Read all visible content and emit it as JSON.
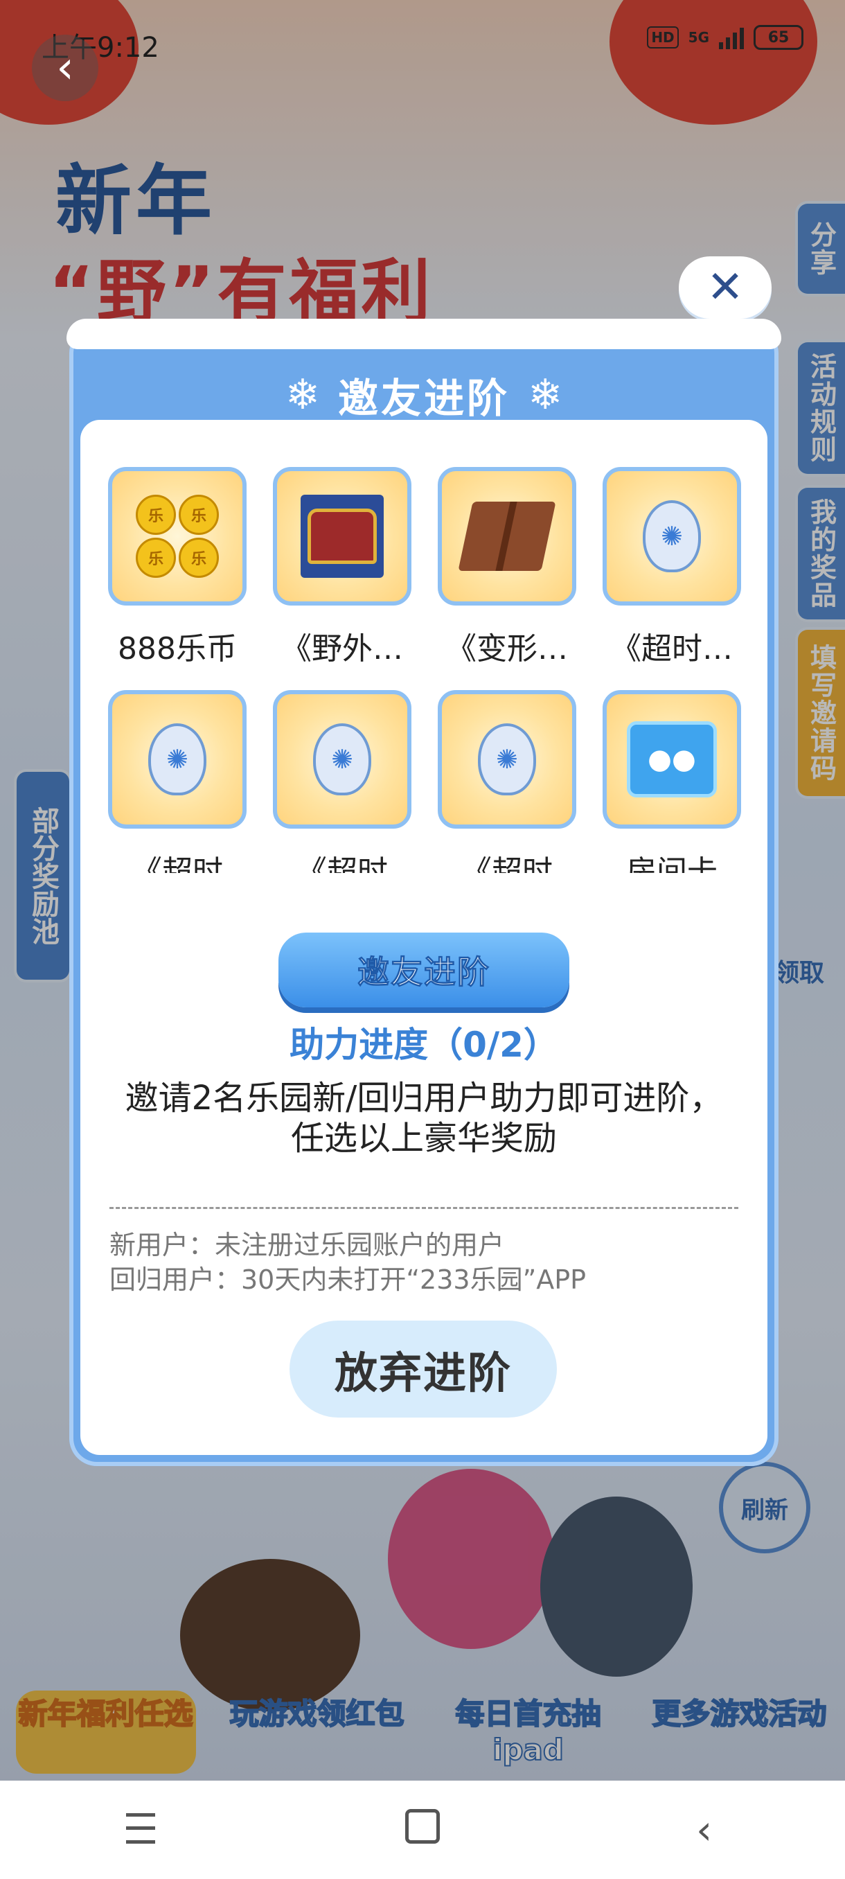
{
  "status_bar": {
    "time": "上午9:12",
    "network": "5G",
    "hd": "HD",
    "battery": "65"
  },
  "background": {
    "title_line1": "新年",
    "title_line2": "“野”有福利",
    "side_tabs": [
      "分享",
      "活动规则",
      "我的奖品",
      "填写邀请码"
    ],
    "left_tab": "部分奖励池",
    "peek_claim": "领取",
    "peek_refresh": "刷新",
    "bottom_nav": [
      "新年福利任选",
      "玩游戏领红包",
      "每日首充抽ipad",
      "更多游戏活动"
    ]
  },
  "modal": {
    "close_icon": "close-icon",
    "title": "邀友进阶",
    "rewards": [
      {
        "name": "888乐币",
        "icon": "coins-icon"
      },
      {
        "name": "《野外…",
        "icon": "treasure-chest-icon"
      },
      {
        "name": "《变形…",
        "icon": "gift-box-icon"
      },
      {
        "name": "《超时…",
        "icon": "egg-book-icon"
      },
      {
        "name": "《超时",
        "icon": "egg-gem-icon"
      },
      {
        "name": "《超时",
        "icon": "egg-crystal-icon"
      },
      {
        "name": "《超时",
        "icon": "egg-potion-icon"
      },
      {
        "name": "房间卡",
        "icon": "room-card-box-icon"
      }
    ],
    "primary_button": "邀友进阶",
    "progress": "助力进度（0/2）",
    "description_line1": "邀请2名乐园新/回归用户助力即可进阶，",
    "description_line2": "任选以上豪华奖励",
    "note_new_user": "新用户：未注册过乐园账户的用户",
    "note_return_user": "回归用户：30天内未打开“233乐园”APP",
    "giveup_button": "放弃进阶"
  },
  "colors": {
    "modal_frame": "#6da8ea",
    "progress_text": "#3a82d6",
    "tile_border": "#8ec0f3",
    "giveup_bg": "#d7ecfc"
  }
}
